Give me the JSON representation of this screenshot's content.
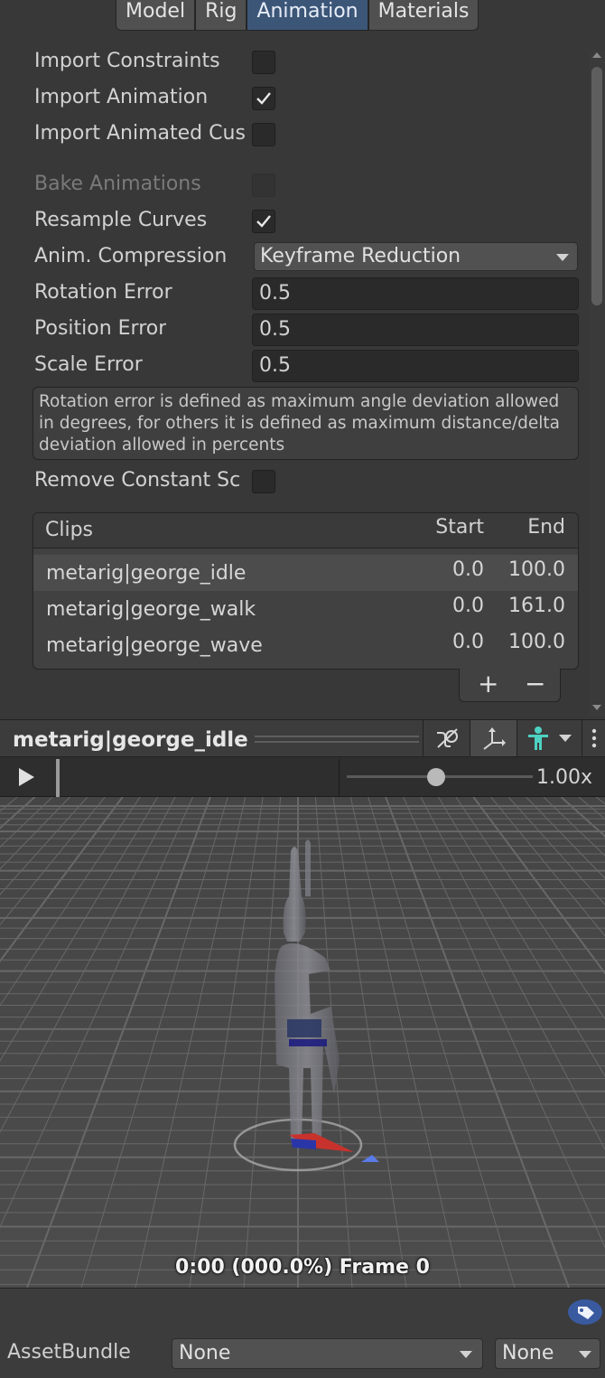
{
  "tabs": [
    {
      "label": "Model"
    },
    {
      "label": "Rig"
    },
    {
      "label": "Animation",
      "active": true
    },
    {
      "label": "Materials"
    }
  ],
  "settings": {
    "import_constraints": {
      "label": "Import Constraints",
      "checked": false
    },
    "import_animation": {
      "label": "Import Animation",
      "checked": true
    },
    "import_animated_custom": {
      "label": "Import Animated Cus",
      "checked": false
    },
    "bake_animations": {
      "label": "Bake Animations",
      "checked": false,
      "disabled": true
    },
    "resample_curves": {
      "label": "Resample Curves",
      "checked": true
    },
    "anim_compression": {
      "label": "Anim. Compression",
      "value": "Keyframe Reduction"
    },
    "rotation_error": {
      "label": "Rotation Error",
      "value": "0.5"
    },
    "position_error": {
      "label": "Position Error",
      "value": "0.5"
    },
    "scale_error": {
      "label": "Scale Error",
      "value": "0.5"
    },
    "help_text": "Rotation error is defined as maximum angle deviation allowed in degrees, for others it is defined as maximum distance/delta deviation allowed in percents",
    "remove_constant_scale": {
      "label": "Remove Constant Sc",
      "checked": false
    }
  },
  "clips": {
    "header": {
      "name": "Clips",
      "start": "Start",
      "end": "End"
    },
    "rows": [
      {
        "name": "metarig|george_idle",
        "start": "0.0",
        "end": "100.0",
        "selected": true
      },
      {
        "name": "metarig|george_walk",
        "start": "0.0",
        "end": "161.0"
      },
      {
        "name": "metarig|george_wave",
        "start": "0.0",
        "end": "100.0"
      }
    ],
    "add_label": "+",
    "remove_label": "−"
  },
  "preview": {
    "title": "metarig|george_idle",
    "speed": "1.00x",
    "speed_level": 0.48,
    "frame_text": "0:00 (000.0%) Frame 0"
  },
  "asset_bundle": {
    "label": "AssetBundle",
    "name_value": "None",
    "variant_value": "None"
  },
  "colors": {
    "accent_tab": "#3c5678",
    "background": "#383838",
    "field": "#2a2a2a"
  },
  "icons": [
    "checkmark-icon",
    "dropdown-arrow-icon",
    "play-icon",
    "pivot-icon",
    "avatar-icon",
    "kebab-menu-icon",
    "tag-icon"
  ]
}
